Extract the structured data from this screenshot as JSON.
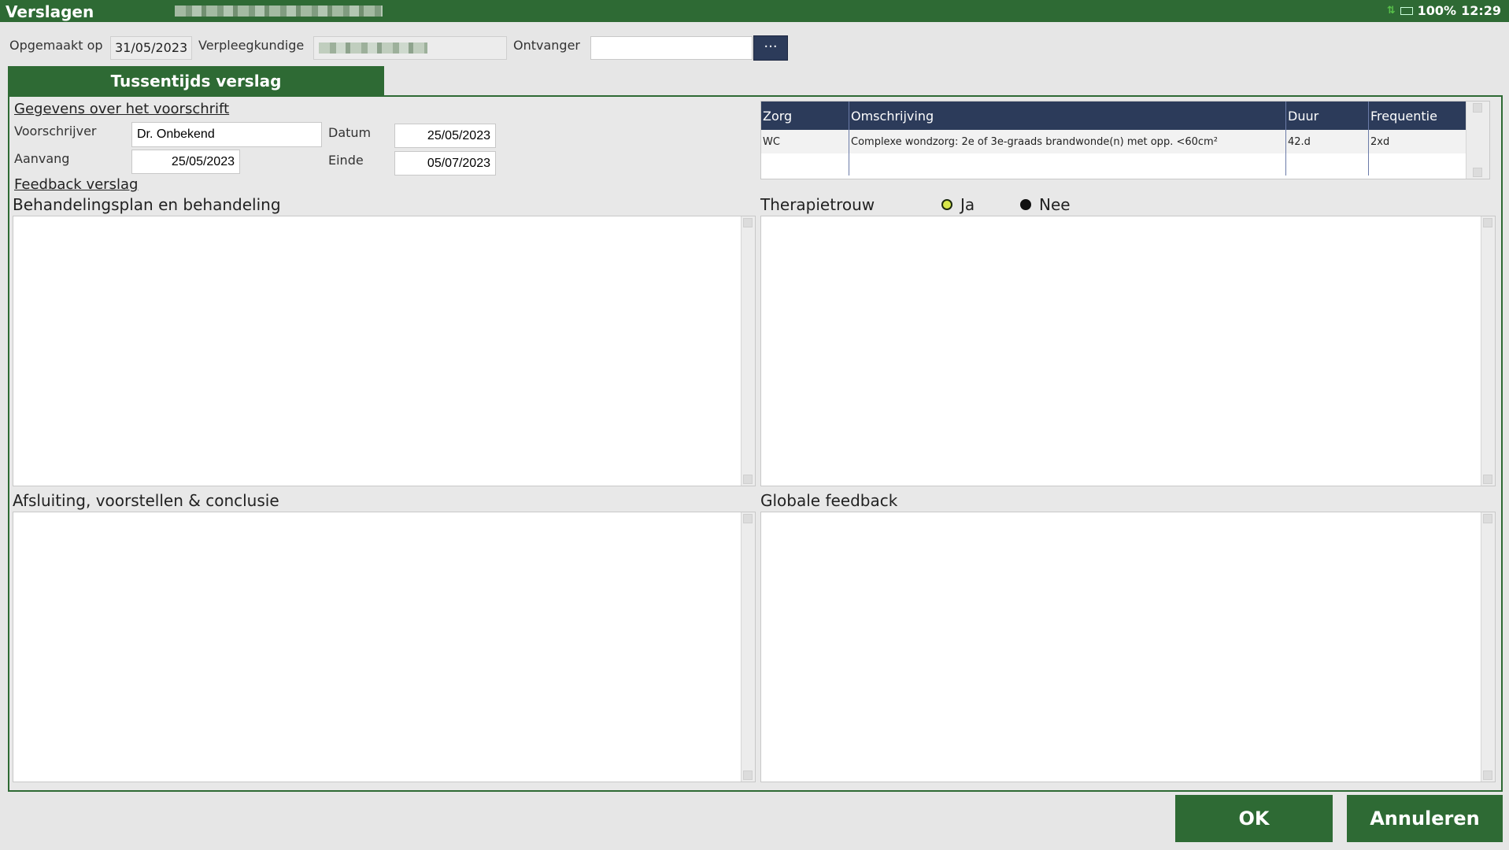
{
  "window": {
    "title": "Verslagen"
  },
  "status": {
    "battery": "100%",
    "time": "12:29"
  },
  "header": {
    "created_label": "Opgemaakt op",
    "created_value": "31/05/2023",
    "nurse_label": "Verpleegkundige",
    "recipient_label": "Ontvanger",
    "recipient_value": "",
    "more_button": "···"
  },
  "tab": {
    "label": "Tussentijds verslag"
  },
  "prescription": {
    "heading": "Gegevens over het voorschrift",
    "prescriber_label": "Voorschrijver",
    "prescriber_value": "Dr. Onbekend",
    "date_label": "Datum",
    "date_value": "25/05/2023",
    "start_label": "Aanvang",
    "start_value": "25/05/2023",
    "end_label": "Einde",
    "end_value": "05/07/2023"
  },
  "care_table": {
    "columns": [
      "Zorg",
      "Omschrijving",
      "Duur",
      "Frequentie"
    ],
    "rows": [
      {
        "zorg": "WC",
        "omschrijving": "Complexe wondzorg: 2e of 3e-graads brandwonde(n) met opp. <60cm²",
        "duur": "42.d",
        "frequentie": "2xd"
      }
    ]
  },
  "feedback": {
    "heading": "Feedback verslag",
    "treatment_label": "Behandelingsplan en behandeling",
    "adherence_label": "Therapietrouw",
    "adherence_yes": "Ja",
    "adherence_no": "Nee",
    "closing_label": "Afsluiting, voorstellen & conclusie",
    "global_label": "Globale feedback"
  },
  "actions": {
    "ok": "OK",
    "cancel": "Annuleren"
  },
  "colors": {
    "primary_green": "#2e6a34",
    "table_header_navy": "#2c3b5a",
    "radio_selected": "#d8e84a"
  },
  "icons": [
    "more-dots-icon",
    "network-arrows-icon",
    "battery-icon"
  ]
}
